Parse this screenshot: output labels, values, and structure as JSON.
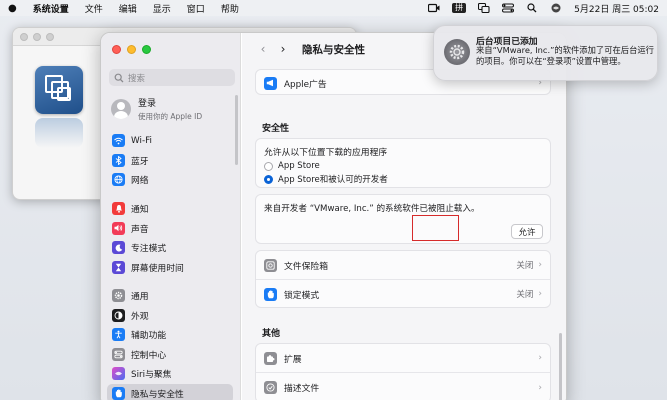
{
  "menubar": {
    "app": "系统设置",
    "menus": [
      "文件",
      "编辑",
      "显示",
      "窗口",
      "帮助"
    ],
    "input_method": "拼",
    "datetime": "5月22日 周三 05:02"
  },
  "sidebar": {
    "search_placeholder": "搜索",
    "account": {
      "title": "登录",
      "subtitle": "使用你的 Apple ID"
    },
    "groups": [
      [
        {
          "label": "Wi-Fi",
          "icon": "wifi-icon",
          "color": "#1a7cf5"
        },
        {
          "label": "蓝牙",
          "icon": "bluetooth-icon",
          "color": "#1a7cf5"
        },
        {
          "label": "网络",
          "icon": "network-icon",
          "color": "#1a7cf5"
        }
      ],
      [
        {
          "label": "通知",
          "icon": "bell-icon",
          "color": "#f23b3b"
        },
        {
          "label": "声音",
          "icon": "speaker-icon",
          "color": "#f23b57"
        },
        {
          "label": "专注模式",
          "icon": "moon-icon",
          "color": "#5b49d6"
        },
        {
          "label": "屏幕使用时间",
          "icon": "hourglass-icon",
          "color": "#5b49d6"
        }
      ],
      [
        {
          "label": "通用",
          "icon": "gear-icon",
          "color": "#8e8e93"
        },
        {
          "label": "外观",
          "icon": "appearance-icon",
          "color": "#1d1d1f"
        },
        {
          "label": "辅助功能",
          "icon": "accessibility-icon",
          "color": "#1a7cf5"
        },
        {
          "label": "控制中心",
          "icon": "control-center-icon",
          "color": "#8e8e93"
        },
        {
          "label": "Siri与聚焦",
          "icon": "siri-icon",
          "color": "#b54ad9"
        },
        {
          "label": "隐私与安全性",
          "icon": "hand-icon",
          "color": "#1a7cf5",
          "active": true
        }
      ]
    ]
  },
  "content": {
    "title": "隐私与安全性",
    "apple_ads": "Apple广告",
    "security_title": "安全性",
    "allow_from_label": "允许从以下位置下载的应用程序",
    "option_app_store": "App Store",
    "option_app_store_dev": "App Store和被认可的开发者",
    "blocked_text": "来自开发者 “VMware, Inc.” 的系统软件已被阻止载入。",
    "allow_button": "允许",
    "filevault": {
      "label": "文件保险箱",
      "value": "关闭"
    },
    "lockdown": {
      "label": "锁定模式",
      "value": "关闭"
    },
    "other_title": "其他",
    "extensions": "扩展",
    "profiles": "描述文件"
  },
  "notification": {
    "title": "后台项目已添加",
    "body": "来自“VMware, Inc.”的软件添加了可在后台运行的项目。你可以在“登录项”设置中管理。"
  }
}
